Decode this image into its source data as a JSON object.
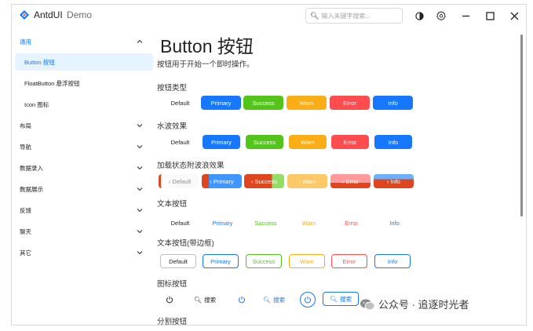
{
  "app": {
    "title": "AntdUI",
    "subtitle": "Demo"
  },
  "search": {
    "placeholder": "输入关键字搜索..."
  },
  "sidebar": {
    "groups": [
      {
        "label": "通用",
        "expanded": true,
        "items": [
          {
            "label": "Button 按钮",
            "active": true
          },
          {
            "label": "FloatButton 悬浮按钮"
          },
          {
            "label": "Icon 图标"
          }
        ]
      },
      {
        "label": "布局"
      },
      {
        "label": "导航"
      },
      {
        "label": "数据录入"
      },
      {
        "label": "数据展示"
      },
      {
        "label": "反馈"
      },
      {
        "label": "聊天"
      },
      {
        "label": "其它"
      }
    ]
  },
  "page": {
    "title": "Button 按钮",
    "description": "按钮用于开始一个即时操作。",
    "sections": {
      "types": "按钮类型",
      "wave": "水波效果",
      "loading": "加载状态附波浪效果",
      "text": "文本按钮",
      "text_border": "文本按钮(带边框)",
      "icon": "图标按钮",
      "split": "分割按钮"
    },
    "buttons": {
      "default": "Default",
      "primary": "Primary",
      "success": "Success",
      "warn": "Warn",
      "error": "Error",
      "info": "Info",
      "search": "搜索"
    }
  },
  "colors": {
    "primary": "#1677ff",
    "success": "#52c41a",
    "warn": "#faad14",
    "error": "#ff4d4f",
    "info": "#1677ff"
  },
  "watermark": "公众号 · 追逐时光者"
}
